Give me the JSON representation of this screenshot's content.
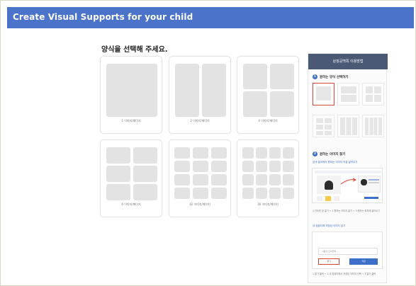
{
  "header": {
    "title": "Create Visual Supports for your child"
  },
  "main": {
    "title": "양식을 선택해 주세요.",
    "layouts": [
      {
        "label": "1 이미지/페이지"
      },
      {
        "label": "2 이미지/페이지"
      },
      {
        "label": "4 이미지/페이지"
      },
      {
        "label": "6 이미지/페이지"
      },
      {
        "label": "12 이미지/페이지"
      },
      {
        "label": "16 이미지/페이지"
      }
    ]
  },
  "help": {
    "title": "상징공백쪽 이용방법",
    "step1": {
      "num": "1",
      "label": "원하는 양식 선택하기"
    },
    "step2": {
      "num": "2",
      "label": "원하는 이미지 찾기"
    },
    "step2_link": "검색 결과에서 원하는 이미지 직접 끌어오기",
    "step2_note": "1 인터넷 창 열기 → 2 원하는 이미지 끌기 → 3 원하는 위치에 끌어오기",
    "step3_link": "내 컴퓨터에 저장된 이미지 넣기",
    "step3_input": "사용할 단어입력",
    "step3_btn_cancel": "찾기",
    "step3_btn_ok": "저장",
    "step3_note": "1 찾기 클릭 → 2 내 컴퓨터에서 저장된 이미지 선택 → 3 열기 클릭"
  },
  "colors": {
    "header": "#4a73c9",
    "help_header": "#4a5a75",
    "accent": "#3d6fc8",
    "highlight": "#e0443a"
  }
}
